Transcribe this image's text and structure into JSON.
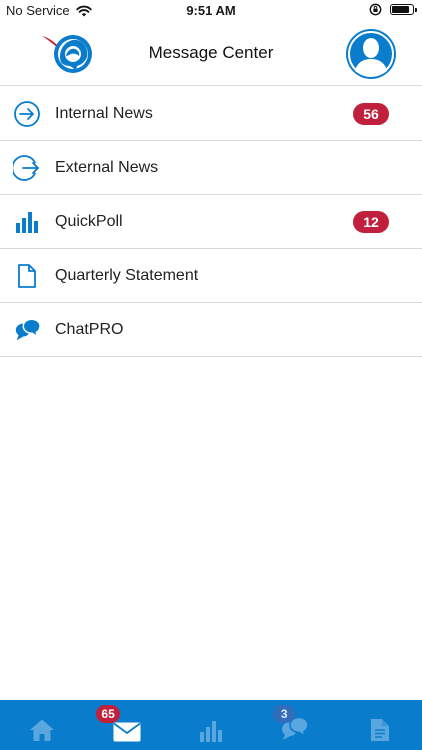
{
  "status_bar": {
    "carrier": "No Service",
    "time": "9:51 AM",
    "battery_level": 0.85
  },
  "header": {
    "title": "Message Center",
    "logo_icon": "app-logo-icon",
    "avatar_icon": "user-avatar-icon"
  },
  "menu": {
    "items": [
      {
        "label": "Internal News",
        "icon": "arrow-circle-right-icon",
        "badge": "56"
      },
      {
        "label": "External News",
        "icon": "arrow-circle-exit-icon",
        "badge": ""
      },
      {
        "label": "QuickPoll",
        "icon": "bar-chart-icon",
        "badge": "12"
      },
      {
        "label": "Quarterly Statement",
        "icon": "document-icon",
        "badge": ""
      },
      {
        "label": "ChatPRO",
        "icon": "chat-bubbles-icon",
        "badge": ""
      }
    ]
  },
  "tab_bar": {
    "tabs": [
      {
        "icon": "home-icon",
        "badge": ""
      },
      {
        "icon": "mail-icon",
        "badge": "65"
      },
      {
        "icon": "bar-chart-icon",
        "badge": ""
      },
      {
        "icon": "chat-icon",
        "badge": "3"
      },
      {
        "icon": "document-icon",
        "badge": ""
      }
    ]
  },
  "colors": {
    "brand_blue": "#0a7ccc",
    "badge_red": "#c0203b",
    "divider": "#d8d8d8"
  }
}
